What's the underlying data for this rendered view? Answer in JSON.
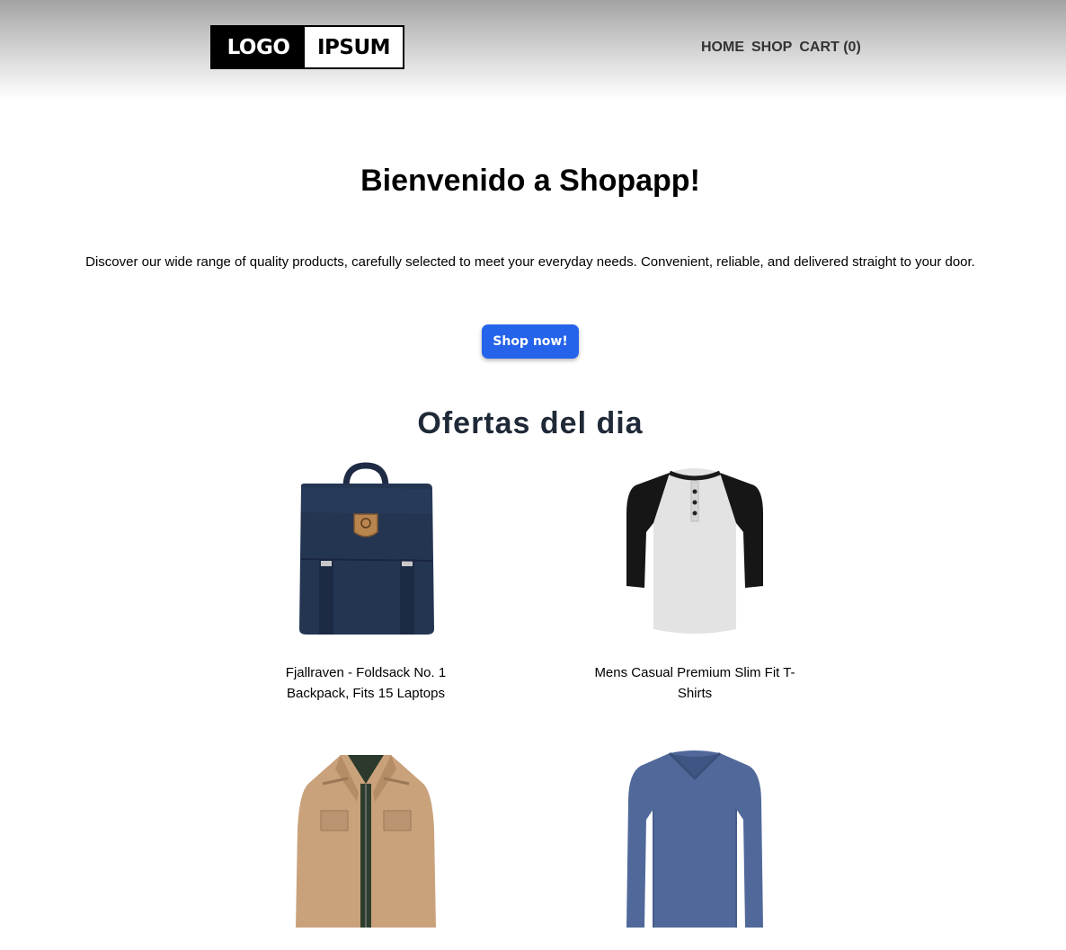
{
  "logo": {
    "part1": "LOGO",
    "part2": "IPSUM"
  },
  "nav": {
    "home": "HOME",
    "shop": "SHOP",
    "cart": "CART (0)"
  },
  "hero": {
    "title": "Bienvenido a Shopapp!",
    "description": "Discover our wide range of quality products, carefully selected to meet your everyday needs. Convenient, reliable, and delivered straight to your door.",
    "button_label": "Shop now!"
  },
  "offers": {
    "title": "Ofertas del dia",
    "products": [
      {
        "name": "Fjallraven - Foldsack No. 1 Backpack, Fits 15 Laptops",
        "image": "backpack-image"
      },
      {
        "name": "Mens Casual Premium Slim Fit T-Shirts",
        "image": "tshirt-image"
      },
      {
        "name": "",
        "image": "jacket-image"
      },
      {
        "name": "",
        "image": "longsleeve-image"
      }
    ]
  },
  "colors": {
    "accent": "#2563eb",
    "section_title": "#1f2937",
    "nav_text": "#333333"
  }
}
